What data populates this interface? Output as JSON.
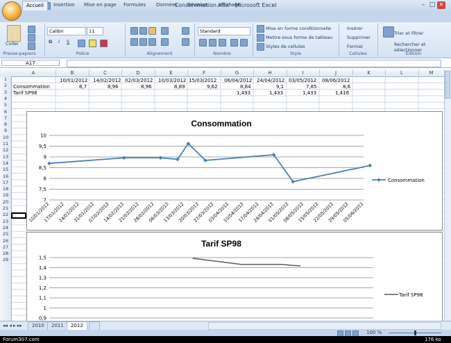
{
  "window": {
    "title": "Consommation.xlsx - Microsoft Excel"
  },
  "tabs": [
    "Accueil",
    "Insertion",
    "Mise en page",
    "Formules",
    "Données",
    "Révision",
    "Affichage"
  ],
  "ribbon": {
    "presse_papiers": {
      "coller": "Coller",
      "label": "Presse-papiers"
    },
    "police": {
      "font": "Calibri",
      "size": "11",
      "label": "Police"
    },
    "alignement": {
      "label": "Alignement"
    },
    "nombre": {
      "format": "Standard",
      "label": "Nombre"
    },
    "style": {
      "items": [
        "Mise en forme conditionnelle",
        "Mettre sous forme de tableau",
        "Styles de cellules"
      ],
      "label": "Style"
    },
    "cellules": {
      "items": [
        "Insérer",
        "Supprimer",
        "Format"
      ],
      "label": "Cellules"
    },
    "edition": {
      "items": [
        "Trier et filtrer",
        "Rechercher et sélectionner"
      ],
      "label": "Édition"
    }
  },
  "formula_bar": {
    "cell_ref": "A17"
  },
  "grid": {
    "columns": [
      "A",
      "B",
      "C",
      "D",
      "E",
      "F",
      "G",
      "H",
      "I",
      "J",
      "K",
      "L",
      "M"
    ],
    "rows": [
      "1",
      "2",
      "3",
      "4",
      "5",
      "6",
      "7",
      "8",
      "9",
      "10",
      "11",
      "12",
      "13",
      "14",
      "15",
      "16",
      "17",
      "18",
      "19",
      "20",
      "21",
      "22",
      "23",
      "24",
      "25",
      "26",
      "27",
      "28",
      "29"
    ],
    "row1": [
      "10/01/2012",
      "14/02/2012",
      "02/03/2012",
      "10/03/2012",
      "15/03/2012",
      "06/04/2012",
      "24/04/2012",
      "03/05/2012",
      "08/06/2012"
    ],
    "row2_label": "Consommation",
    "row2": [
      "8,7",
      "8,96",
      "8,96",
      "8,89",
      "9,62",
      "8,84",
      "9,1",
      "7,85",
      "8,6"
    ],
    "row3_label": "Tarif SP98",
    "row3": [
      "1,493",
      "1,433",
      "1,433",
      "1,416"
    ]
  },
  "chart_data": [
    {
      "type": "line",
      "title": "Consommation",
      "x": [
        "10/01/2012",
        "17/01/2012",
        "24/01/2012",
        "31/01/2012",
        "07/02/2012",
        "14/02/2012",
        "21/02/2012",
        "28/02/2012",
        "06/03/2012",
        "13/03/2012",
        "20/03/2012",
        "27/03/2012",
        "03/04/2012",
        "10/04/2012",
        "17/04/2012",
        "24/04/2012",
        "01/05/2012",
        "08/05/2012",
        "15/05/2012",
        "22/05/2012",
        "29/05/2012",
        "05/06/2012"
      ],
      "yticks": [
        "10",
        "9,5",
        "9",
        "8,5",
        "8",
        "7,5",
        "7"
      ],
      "ylim": [
        7,
        10
      ],
      "series": [
        {
          "name": "Consommation",
          "color": "#4a7ebb",
          "points": [
            [
              "10/01/2012",
              8.7
            ],
            [
              "14/02/2012",
              8.96
            ],
            [
              "02/03/2012",
              8.96
            ],
            [
              "10/03/2012",
              8.89
            ],
            [
              "15/03/2012",
              9.62
            ],
            [
              "23/03/2012",
              8.84
            ],
            [
              "24/04/2012",
              9.1
            ],
            [
              "03/05/2012",
              7.85
            ],
            [
              "08/06/2012",
              8.6
            ]
          ]
        }
      ],
      "legend": "right",
      "grid": true
    },
    {
      "type": "line",
      "title": "Tarif SP98",
      "yticks": [
        "1,5",
        "1,4",
        "1,3",
        "1,2",
        "1,1",
        "1",
        "0,9"
      ],
      "ylim": [
        0.9,
        1.5
      ],
      "series": [
        {
          "name": "Tarif SP98",
          "color": "#5a5a5a",
          "points": [
            [
              "15/03/2012",
              1.493
            ],
            [
              "06/04/2012",
              1.433
            ],
            [
              "24/04/2012",
              1.433
            ],
            [
              "03/05/2012",
              1.416
            ]
          ]
        }
      ],
      "legend": "right",
      "grid": true
    }
  ],
  "sheet_tabs": [
    "2010",
    "2011",
    "2012"
  ],
  "status": {
    "zoom": "100 %",
    "footer_left": "Forum307.com",
    "footer_right": "176 ko"
  }
}
